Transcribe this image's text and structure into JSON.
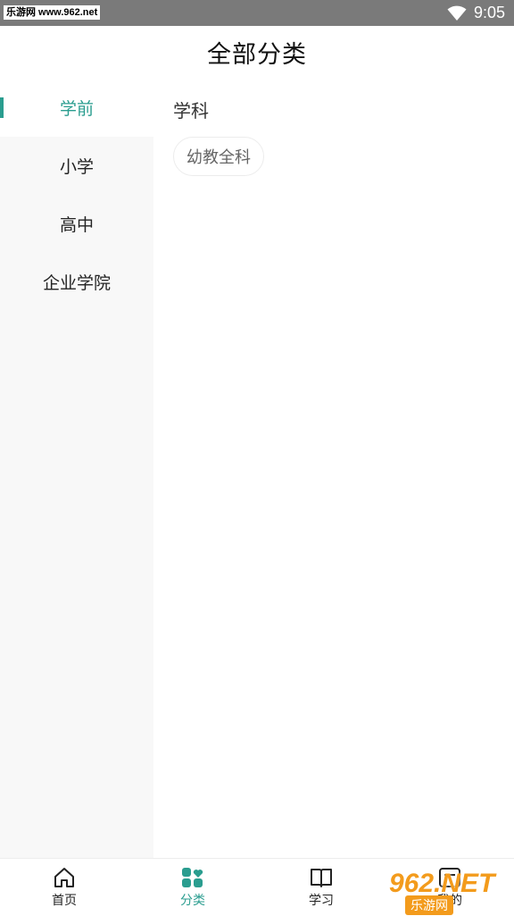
{
  "status_bar": {
    "watermark_text": "乐游网 www.962.net",
    "time": "9:05",
    "wifi_icon": "wifi-icon"
  },
  "header": {
    "title": "全部分类"
  },
  "sidebar": {
    "items": [
      {
        "label": "学前",
        "active": true
      },
      {
        "label": "小学",
        "active": false
      },
      {
        "label": "高中",
        "active": false
      },
      {
        "label": "企业学院",
        "active": false
      }
    ]
  },
  "content": {
    "section_title": "学科",
    "chips": [
      {
        "label": "幼教全科"
      }
    ]
  },
  "tabbar": {
    "tabs": [
      {
        "label": "首页",
        "icon": "home-icon"
      },
      {
        "label": "分类",
        "icon": "category-icon",
        "active": true
      },
      {
        "label": "学习",
        "icon": "book-icon"
      },
      {
        "label": "我的",
        "icon": "profile-icon"
      }
    ]
  },
  "overlay_watermark": {
    "top": "962.NET",
    "bottom": "乐游网"
  },
  "colors": {
    "accent": "#2a9d8f",
    "status_bar": "#7a7a7a"
  }
}
